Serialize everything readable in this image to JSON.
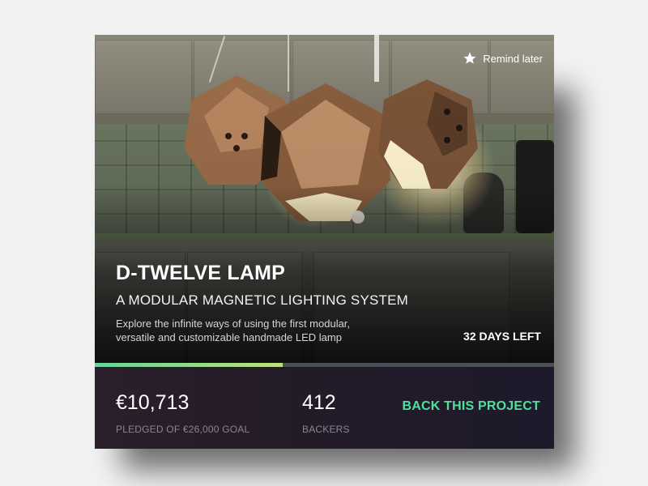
{
  "project": {
    "title": "D-TWELVE LAMP",
    "subtitle": "A MODULAR MAGNETIC LIGHTING SYSTEM",
    "description": "Explore the infinite ways of using the first modular, versatile and customizable handmade LED lamp",
    "days_left": "32 DAYS LEFT",
    "progress_fraction": 0.41
  },
  "actions": {
    "remind_label": "Remind later",
    "remind_icon": "star-icon",
    "back_label": "BACK THIS PROJECT"
  },
  "stats": {
    "pledged_value": "€10,713",
    "pledged_label": "PLEDGED OF €26,000 GOAL",
    "backers_value": "412",
    "backers_label": "BACKERS"
  },
  "colors": {
    "accent": "#4fe09a",
    "progress_start": "#67d39a",
    "progress_end": "#bde07a",
    "footer_bg": "#241b29"
  }
}
